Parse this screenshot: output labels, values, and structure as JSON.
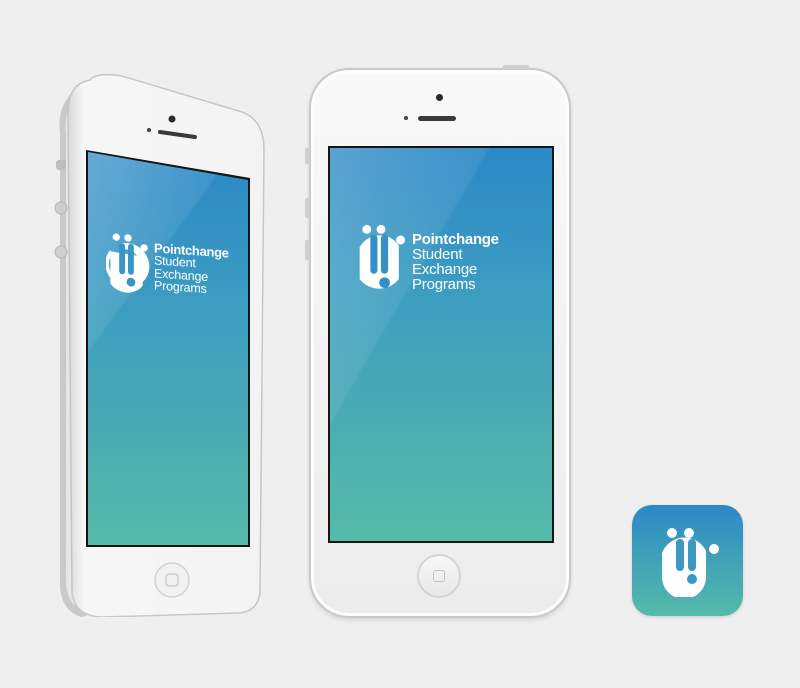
{
  "app": {
    "brand": "Pointchange",
    "tagline_line1": "Student",
    "tagline_line2": "Exchange",
    "tagline_line3": "Programs"
  },
  "colors": {
    "gradient_top": "#2b88c6",
    "gradient_bottom": "#55bba9",
    "background": "#efefef",
    "phone_body": "#f5f5f5"
  },
  "icons": {
    "logo": "pointchange-logo-icon",
    "app_icon": "pointchange-app-icon"
  }
}
